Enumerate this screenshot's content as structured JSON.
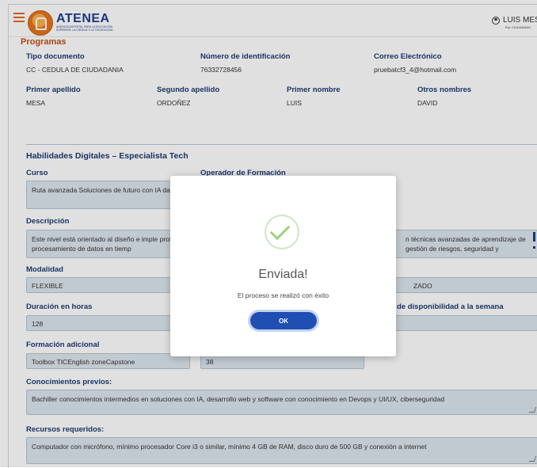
{
  "header": {
    "brand": "ATENEA",
    "brand_sub": "AGENCIA DISTRITAL PARA LA EDUCACIÓN SUPERIOR, LA CIENCIA Y LA TECNOLOGÍA",
    "user_name": "LUIS MESA",
    "user_role": "Rol: CIUDADANO"
  },
  "section": {
    "title": "Programas"
  },
  "personal": {
    "tipo_doc_label": "Tipo documento",
    "tipo_doc_value": "CC - CEDULA DE CIUDADANIA",
    "num_id_label": "Número de identificación",
    "num_id_value": "76332728456",
    "email_label": "Correo Electrónico",
    "email_value": "pruebatcf3_4@hotmail.com",
    "primer_apellido_label": "Primer apellido",
    "primer_apellido_value": "MESA",
    "segundo_apellido_label": "Segundo apellido",
    "segundo_apellido_value": "ORDOÑEZ",
    "primer_nombre_label": "Primer nombre",
    "primer_nombre_value": "LUIS",
    "otros_nombres_label": "Otros nombres",
    "otros_nombres_value": "DAVID"
  },
  "program": {
    "title": "Habilidades Digitales – Especialista Tech",
    "curso_label": "Curso",
    "curso_value": "Ruta avanzada Soluciones de futuro con IA datos",
    "operador_label": "Operador de Formación",
    "descripcion_label": "Descripción",
    "descripcion_left": "Este nivel está orientado al diseño e imple profundo, procesamiento de datos en tiemp",
    "descripcion_right": "n técnicas avanzadas de aprendizaje de gestión de riesgos, seguridad y",
    "modalidad_label": "Modalidad",
    "modalidad_value": "FLEXIBLE",
    "modalidad_right": "ZADO",
    "duracion_label": "Duración en horas",
    "duracion_value": "128",
    "disponibilidad_label": "de disponibilidad a la semana",
    "formacion_label": "Formación adicional",
    "formacion_value": "Toolbox TICEnglish zoneCapstone",
    "formacion_hours": "38",
    "conocimientos_label": "Conocimientos previos:",
    "conocimientos_value": "Bachiller conocimientos intermedios en soluciones con IA, desarrollo web y software con conocimiento en Devops y UI/UX, ciberseguridad",
    "recursos_label": "Recursos requeridos:",
    "recursos_value": "Computador con micrófono, mínimo procesador Core i3 o similar, mínimo 4 GB de RAM, disco duro de 500 GB y conexión a internet"
  },
  "modal": {
    "title": "Enviada!",
    "message": "El proceso se realizó con éxito",
    "ok_label": "OK"
  },
  "colors": {
    "accent": "#1f4fb3",
    "label": "#1d3b73",
    "section": "#c1501a",
    "success": "#9fd27a"
  },
  "icons": [
    "menu-icon",
    "atenea-logo-icon",
    "user-icon",
    "success-check-icon"
  ]
}
